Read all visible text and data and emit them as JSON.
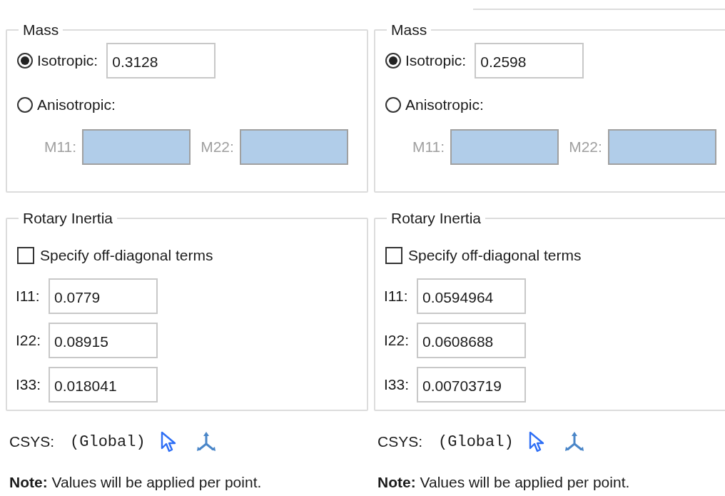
{
  "panels": [
    {
      "mass": {
        "title": "Mass",
        "options": [
          {
            "label": "Isotropic:",
            "selected": true,
            "value": "0.3128"
          },
          {
            "label": "Anisotropic:",
            "selected": false
          }
        ],
        "matrix_disabled": true,
        "matrix_fields": [
          {
            "label": "M11:"
          },
          {
            "label": "M22:"
          }
        ]
      },
      "rotary": {
        "title": "Rotary Inertia",
        "checkbox": {
          "label": "Specify off-diagonal terms",
          "checked": false
        },
        "fields": [
          {
            "label": "I11:",
            "value": "0.0779"
          },
          {
            "label": "I22:",
            "value": "0.08915"
          },
          {
            "label": "I33:",
            "value": "0.018041"
          }
        ]
      },
      "csys": {
        "label": "CSYS:",
        "value": "(Global)"
      },
      "note": "**Note:**  Values will be applied per point."
    },
    {
      "mass": {
        "title": "Mass",
        "options": [
          {
            "label": "Isotropic:",
            "selected": true,
            "value": "0.2598"
          },
          {
            "label": "Anisotropic:",
            "selected": false
          }
        ],
        "matrix_disabled": true,
        "matrix_fields": [
          {
            "label": "M11:"
          },
          {
            "label": "M22:"
          }
        ]
      },
      "rotary": {
        "title": "Rotary Inertia",
        "checkbox": {
          "label": "Specify off-diagonal terms",
          "checked": false
        },
        "fields": [
          {
            "label": "I11:",
            "value": "0.0594964"
          },
          {
            "label": "I22:",
            "value": "0.0608688"
          },
          {
            "label": "I33:",
            "value": "0.00703719"
          }
        ]
      },
      "csys": {
        "label": "CSYS:",
        "value": "(Global)"
      },
      "note": "**Note:**  Values will be applied per point."
    }
  ]
}
